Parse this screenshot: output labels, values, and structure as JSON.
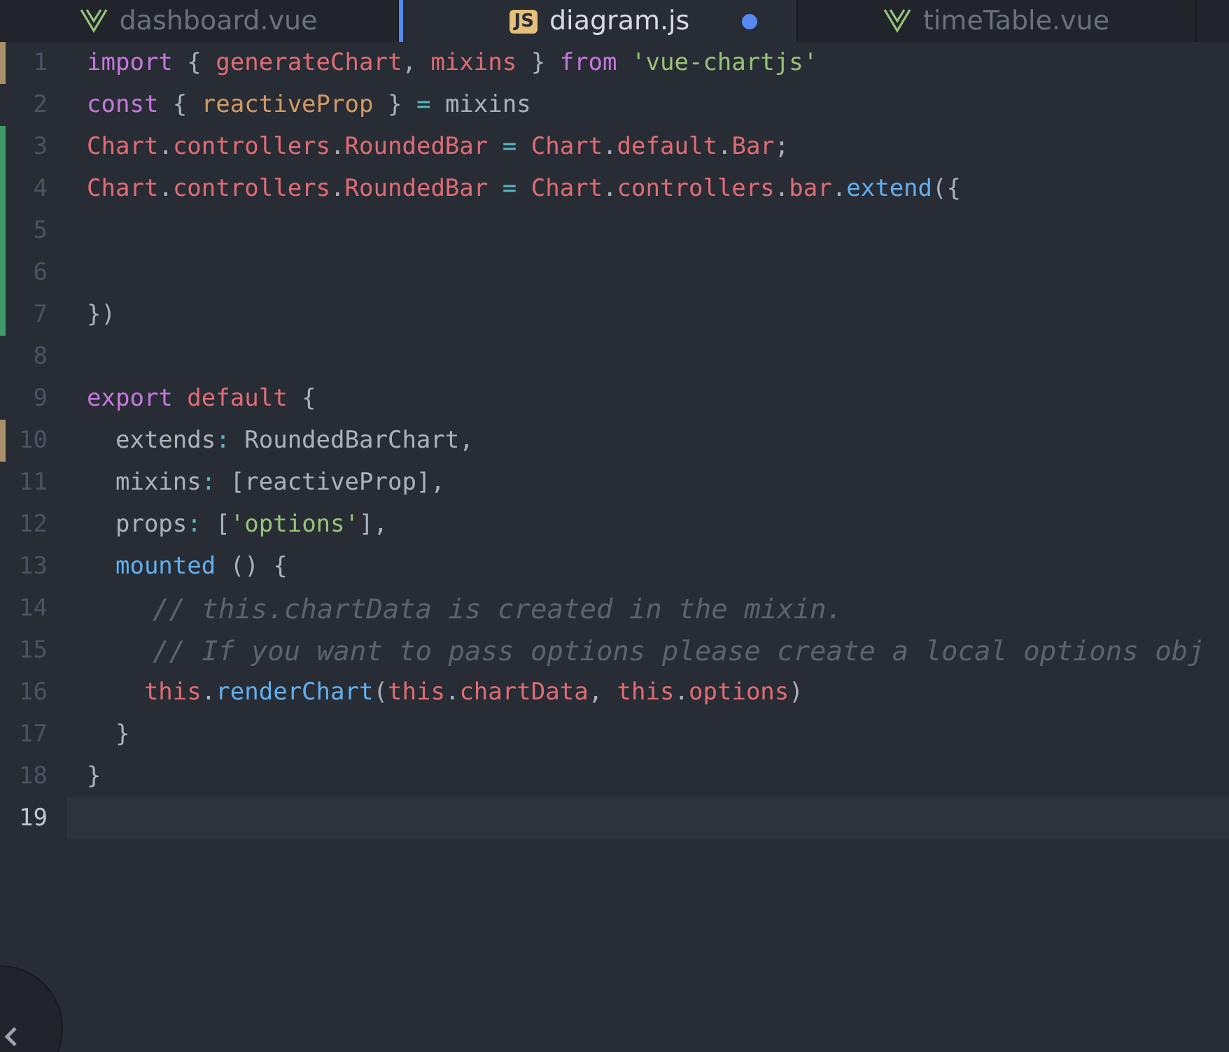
{
  "tabs": [
    {
      "label": "dashboard.vue",
      "kind": "vue",
      "selected": false,
      "modified": false
    },
    {
      "label": "diagram.js",
      "kind": "js",
      "badge": "JS",
      "selected": true,
      "modified": true
    },
    {
      "label": "timeTable.vue",
      "kind": "vue",
      "selected": false,
      "modified": false
    }
  ],
  "lines": [
    {
      "number": "1",
      "kind": "modified",
      "cursor": false,
      "tokens": [
        {
          "text": "import",
          "kind": "kw"
        },
        {
          "text": " { ",
          "kind": "p"
        },
        {
          "text": "generateChart",
          "kind": "var"
        },
        {
          "text": ", ",
          "kind": "p"
        },
        {
          "text": "mixins",
          "kind": "var"
        },
        {
          "text": " } ",
          "kind": "p"
        },
        {
          "text": "from",
          "kind": "kw"
        },
        {
          "text": " 'vue-chartjs'",
          "kind": "str"
        }
      ]
    },
    {
      "number": "2",
      "kind": "plain",
      "cursor": false,
      "tokens": [
        {
          "text": "const",
          "kind": "kw"
        },
        {
          "text": " { ",
          "kind": "p"
        },
        {
          "text": "reactiveProp",
          "kind": "const"
        },
        {
          "text": " } ",
          "kind": "p"
        },
        {
          "text": "= ",
          "kind": "op"
        },
        {
          "text": "mixins",
          "kind": "p"
        }
      ]
    },
    {
      "number": "3",
      "kind": "added",
      "cursor": false,
      "tokens": [
        {
          "text": "Chart",
          "kind": "var"
        },
        {
          "text": ".",
          "kind": "p"
        },
        {
          "text": "controllers",
          "kind": "var"
        },
        {
          "text": ".",
          "kind": "p"
        },
        {
          "text": "RoundedBar",
          "kind": "var"
        },
        {
          "text": " = ",
          "kind": "op"
        },
        {
          "text": "Chart",
          "kind": "var"
        },
        {
          "text": ".",
          "kind": "p"
        },
        {
          "text": "default",
          "kind": "var"
        },
        {
          "text": ".",
          "kind": "p"
        },
        {
          "text": "Bar",
          "kind": "var"
        },
        {
          "text": ";",
          "kind": "p"
        }
      ]
    },
    {
      "number": "4",
      "kind": "added",
      "cursor": false,
      "tokens": [
        {
          "text": "Chart",
          "kind": "var"
        },
        {
          "text": ".",
          "kind": "p"
        },
        {
          "text": "controllers",
          "kind": "var"
        },
        {
          "text": ".",
          "kind": "p"
        },
        {
          "text": "RoundedBar",
          "kind": "var"
        },
        {
          "text": " = ",
          "kind": "op"
        },
        {
          "text": "Chart",
          "kind": "var"
        },
        {
          "text": ".",
          "kind": "p"
        },
        {
          "text": "controllers",
          "kind": "var"
        },
        {
          "text": ".",
          "kind": "p"
        },
        {
          "text": "bar",
          "kind": "var"
        },
        {
          "text": ".",
          "kind": "p"
        },
        {
          "text": "extend",
          "kind": "fn"
        },
        {
          "text": "({",
          "kind": "p"
        }
      ]
    },
    {
      "number": "5",
      "kind": "added",
      "cursor": false
    },
    {
      "number": "6",
      "kind": "added",
      "cursor": false
    },
    {
      "number": "7",
      "kind": "added",
      "cursor": false,
      "tokens": [
        {
          "text": "})",
          "kind": "p"
        }
      ]
    },
    {
      "number": "8",
      "kind": "plain",
      "cursor": false
    },
    {
      "number": "9",
      "kind": "plain",
      "cursor": false,
      "tokens": [
        {
          "text": "export",
          "kind": "kw"
        },
        {
          "text": " default",
          "kind": "var"
        },
        {
          "text": " {",
          "kind": "p"
        }
      ]
    },
    {
      "number": "10",
      "kind": "modified",
      "cursor": false,
      "tokens": [
        {
          "text": "  extends",
          "kind": "p"
        },
        {
          "text": ":",
          "kind": "op"
        },
        {
          "text": " RoundedBarChart,",
          "kind": "p"
        }
      ]
    },
    {
      "number": "11",
      "kind": "plain",
      "cursor": false,
      "tokens": [
        {
          "text": "  mixins",
          "kind": "p"
        },
        {
          "text": ":",
          "kind": "op"
        },
        {
          "text": " [reactiveProp],",
          "kind": "p"
        }
      ]
    },
    {
      "number": "12",
      "kind": "plain",
      "cursor": false,
      "tokens": [
        {
          "text": "  props",
          "kind": "p"
        },
        {
          "text": ":",
          "kind": "op"
        },
        {
          "text": " [",
          "kind": "p"
        },
        {
          "text": "'options'",
          "kind": "str"
        },
        {
          "text": "],",
          "kind": "p"
        }
      ]
    },
    {
      "number": "13",
      "kind": "plain",
      "cursor": false,
      "tokens": [
        {
          "text": "  mounted",
          "kind": "fn"
        },
        {
          "text": " () {",
          "kind": "p"
        }
      ]
    },
    {
      "number": "14",
      "kind": "plain",
      "cursor": false,
      "tokens": [
        {
          "text": "    // this.chartData is created in the mixin.",
          "kind": "com"
        }
      ]
    },
    {
      "number": "15",
      "kind": "plain",
      "cursor": false,
      "tokens": [
        {
          "text": "    // If you want to pass options please create a local options obj",
          "kind": "com"
        }
      ]
    },
    {
      "number": "16",
      "kind": "plain",
      "cursor": false,
      "tokens": [
        {
          "text": "    this",
          "kind": "var"
        },
        {
          "text": ".",
          "kind": "p"
        },
        {
          "text": "renderChart",
          "kind": "fn"
        },
        {
          "text": "(",
          "kind": "p"
        },
        {
          "text": "this",
          "kind": "var"
        },
        {
          "text": ".",
          "kind": "p"
        },
        {
          "text": "chartData",
          "kind": "var"
        },
        {
          "text": ", ",
          "kind": "p"
        },
        {
          "text": "this",
          "kind": "var"
        },
        {
          "text": ".",
          "kind": "p"
        },
        {
          "text": "options",
          "kind": "var"
        },
        {
          "text": ")",
          "kind": "p"
        }
      ]
    },
    {
      "number": "17",
      "kind": "plain",
      "cursor": false,
      "tokens": [
        {
          "text": "  }",
          "kind": "p"
        }
      ]
    },
    {
      "number": "18",
      "kind": "plain",
      "cursor": false,
      "tokens": [
        {
          "text": "}",
          "kind": "p"
        }
      ]
    },
    {
      "number": "19",
      "kind": "plain",
      "cursor": true
    }
  ]
}
